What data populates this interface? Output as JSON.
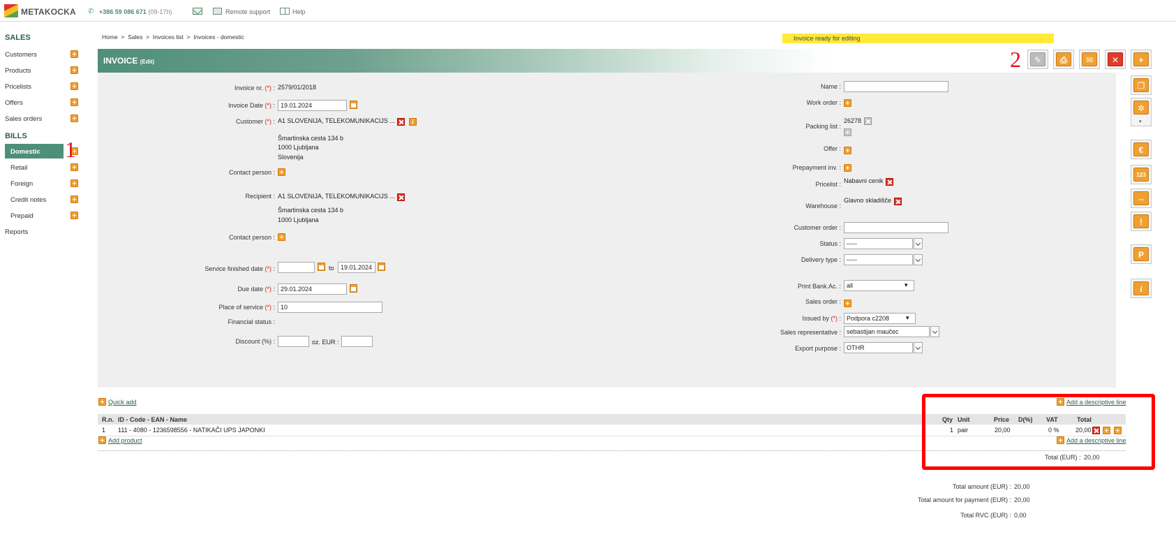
{
  "app": {
    "logo_text": "METAKOCKA"
  },
  "topbar": {
    "phone": "+386 59 086 671",
    "phone_hours": "(09-17h)",
    "remote_support": "Remote support",
    "help": "Help"
  },
  "sidebar": {
    "sales_heading": "SALES",
    "sales_items": [
      "Customers",
      "Products",
      "Pricelists",
      "Offers",
      "Sales orders"
    ],
    "bills_heading": "BILLS",
    "bills_items": [
      "Domestic",
      "Retail",
      "Foreign",
      "Credit notes",
      "Prepaid"
    ],
    "reports": "Reports"
  },
  "markers": {
    "one": "1",
    "two": "2"
  },
  "breadcrumb": {
    "home": "Home",
    "sales": "Sales",
    "list": "Invoices list",
    "current": "Invoices - domestic",
    "sep": ">"
  },
  "status_message": "Invoice ready for editing",
  "header": {
    "title": "INVOICE",
    "mode": "(Edit)"
  },
  "form_left": {
    "invoice_nr_label": "Invoice nr.",
    "invoice_nr": "2579/01/2018",
    "invoice_date_label": "Invoice Date",
    "invoice_date": "19.01.2024",
    "customer_label": "Customer",
    "customer": "A1 SLOVENIJA, TELEKOMUNIKACIJS ...",
    "customer_address": [
      "Šmartinska cesta 134 b",
      "1000 Ljubljana",
      "Slovenija"
    ],
    "contact_person_label": "Contact person :",
    "recipient_label": "Recipient :",
    "recipient": "A1 SLOVENIJA, TELEKOMUNIKACIJS ...",
    "recipient_address": [
      "Šmartinska cesta 134 b",
      "1000 Ljubljana"
    ],
    "service_finished_label": "Service finished date",
    "service_from": "",
    "service_to_label": "to",
    "service_to": "19.01.2024",
    "due_date_label": "Due date",
    "due_date": "29.01.2024",
    "place_label": "Place of service",
    "place": "10",
    "financial_status_label": "Financial status :",
    "discount_label": "Discount (%) :",
    "discount_pct": "",
    "oz_eur_label": "oz. EUR :",
    "discount_eur": "",
    "required_mark": "(*)"
  },
  "form_right": {
    "name_label": "Name :",
    "name": "",
    "work_order_label": "Work order :",
    "packing_list_label": "Packing list :",
    "packing_list": "26278",
    "offer_label": "Offer :",
    "prepayment_label": "Prepayment inv. :",
    "pricelist_label": "Pricelist :",
    "pricelist": "Nabavni cenik",
    "warehouse_label": "Warehouse :",
    "warehouse": "Glavno skladišče",
    "customer_order_label": "Customer order :",
    "customer_order": "",
    "status_label": "Status :",
    "status": "-----",
    "delivery_label": "Delivery type :",
    "delivery": "-----",
    "print_bank_label": "Print Bank.Ac. :",
    "print_bank": "all",
    "sales_order_label": "Sales order :",
    "issued_by_label": "Issued by",
    "issued_by": "Podpora c2208",
    "sales_rep_label": "Sales representative :",
    "sales_rep": "sebastijan maučec",
    "export_label": "Export purpose :",
    "export": "OTHR"
  },
  "toolbar_icons": [
    "pencil-icon",
    "printer-icon",
    "envelope-icon",
    "delete-icon",
    "plus-icon",
    "copy-icon",
    "gear-icon",
    "euro-icon",
    "numbers-icon",
    "split-icon",
    "exclamation-icon",
    "p-icon",
    "info-icon"
  ],
  "toolbar_glyphs": {
    "pencil": "✎",
    "print": "⎙",
    "mail": "✉",
    "delete": "✕",
    "plus": "+",
    "copy": "❐",
    "gear": "✲",
    "euro": "€",
    "numbers": "123",
    "split": "⇔",
    "alert": "!",
    "p": "P",
    "info": "i"
  },
  "items": {
    "quick_add": "Quick add",
    "add_descriptive_line": "Add a descriptive line",
    "add_product": "Add product",
    "columns": [
      "R.n.",
      "ID - Code - EAN - Name",
      "Qty",
      "Unit",
      "Price",
      "D(%)",
      "VAT",
      "Total"
    ],
    "rows": [
      {
        "rn": "1",
        "name": "111 - 4080 - 1236598556 - NATIKAČI UPS JAPONKI",
        "qty": "1",
        "unit": "pair",
        "price": "20,00",
        "discount": "",
        "vat": "0 %",
        "total": "20,00"
      }
    ],
    "total_eur_label": "Total (EUR) :",
    "total_eur": "20,00"
  },
  "totals": {
    "total_amount_label": "Total amount (EUR) :",
    "total_amount": "20,00",
    "payment_label": "Total amount for payment (EUR) :",
    "payment": "20,00",
    "rvc_label": "Total RVC (EUR) :",
    "rvc": "0,00"
  },
  "colors": {
    "accent_green": "#4e8f78",
    "orange": "#f0a030",
    "red": "#e23a2a",
    "status_yellow": "#ffea3a",
    "highlight_red": "#ff0000"
  }
}
